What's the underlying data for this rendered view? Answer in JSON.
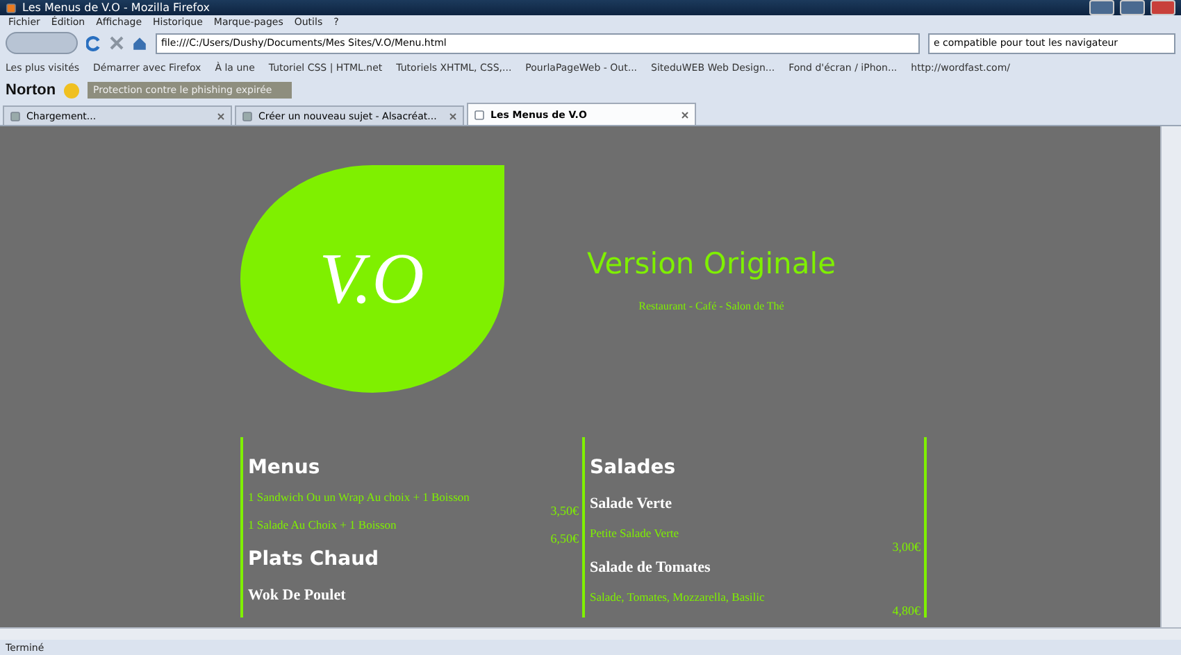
{
  "window": {
    "title": "Les Menus de V.O - Mozilla Firefox"
  },
  "menu": [
    "Fichier",
    "Édition",
    "Affichage",
    "Historique",
    "Marque-pages",
    "Outils",
    "?"
  ],
  "address": {
    "value": "file:///C:/Users/Dushy/Documents/Mes Sites/V.O/Menu.html"
  },
  "search": {
    "value": "e compatible pour tout les navigateur"
  },
  "bookmarks": [
    "Les plus visités",
    "Démarrer avec Firefox",
    "À la une",
    "Tutoriel CSS | HTML.net",
    "Tutoriels XHTML, CSS,...",
    "PourlaPageWeb - Out...",
    "SiteduWEB Web Design...",
    "Fond d'écran / iPhon...",
    "http://wordfast.com/"
  ],
  "norton": {
    "label": "Norton",
    "warning": "Protection contre le phishing expirée"
  },
  "tabs": [
    {
      "label": "Chargement...",
      "selected": false
    },
    {
      "label": "Créer un nouveau sujet - Alsacréat...",
      "selected": false
    },
    {
      "label": "Les Menus de V.O",
      "selected": true
    }
  ],
  "page": {
    "logo": "V.O",
    "title": "Version Originale",
    "subtitle": "Restaurant - Café - Salon de Thé",
    "columns": [
      {
        "entries": [
          {
            "kind": "section",
            "text": "Menus"
          },
          {
            "kind": "line",
            "text": "1 Sandwich Ou un Wrap Au choix + 1 Boisson",
            "price": "3,50€"
          },
          {
            "kind": "line",
            "text": "1 Salade Au Choix + 1 Boisson",
            "price": "6,50€"
          },
          {
            "kind": "section",
            "text": "Plats Chaud"
          },
          {
            "kind": "dish",
            "text": "Wok De Poulet"
          }
        ]
      },
      {
        "entries": [
          {
            "kind": "section",
            "text": "Salades"
          },
          {
            "kind": "dish",
            "text": "Salade Verte"
          },
          {
            "kind": "line",
            "text": "Petite Salade Verte",
            "price": "3,00€"
          },
          {
            "kind": "dish",
            "text": "Salade de Tomates"
          },
          {
            "kind": "line",
            "text": "Salade, Tomates, Mozzarella, Basilic",
            "price": "4,80€"
          }
        ]
      }
    ]
  },
  "status_bar": "Terminé"
}
